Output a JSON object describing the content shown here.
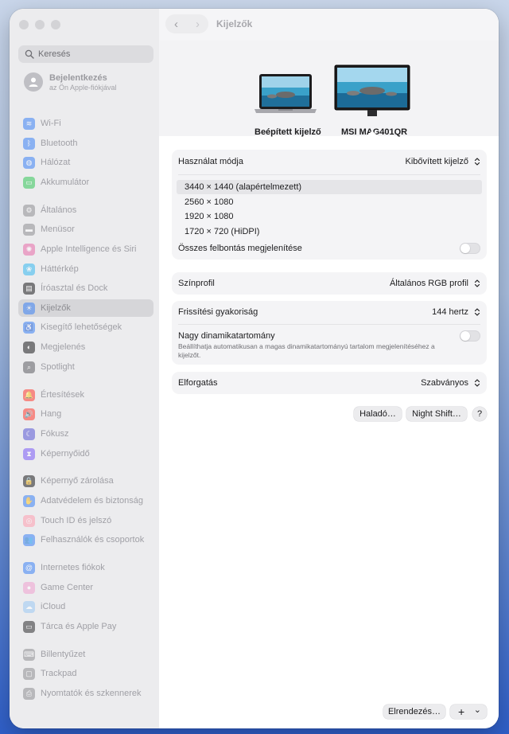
{
  "search": {
    "placeholder": "Keresés"
  },
  "account": {
    "title": "Bejelentkezés",
    "subtitle": "az Ön Apple-fiókjával"
  },
  "sidebar": {
    "items": [
      {
        "label": "Wi-Fi",
        "icon": "wifi-icon",
        "color": "#3b82f6",
        "glyph": "≋",
        "selected": false
      },
      {
        "label": "Bluetooth",
        "icon": "bluetooth-icon",
        "color": "#3b82f6",
        "glyph": "ᛒ",
        "selected": false
      },
      {
        "label": "Hálózat",
        "icon": "globe-icon",
        "color": "#3b82f6",
        "glyph": "◍",
        "selected": false
      },
      {
        "label": "Akkumulátor",
        "icon": "battery-icon",
        "color": "#34c759",
        "glyph": "▭",
        "selected": false
      },
      {
        "label": "Általános",
        "icon": "gear-icon",
        "color": "#8e8e93",
        "glyph": "⚙",
        "selected": false
      },
      {
        "label": "Menüsor",
        "icon": "menubar-icon",
        "color": "#8e8e93",
        "glyph": "▬",
        "selected": false
      },
      {
        "label": "Apple Intelligence és Siri",
        "icon": "siri-icon",
        "color": "#e86ba8",
        "glyph": "✺",
        "selected": false
      },
      {
        "label": "Háttérkép",
        "icon": "wallpaper-icon",
        "color": "#35b8f0",
        "glyph": "❀",
        "selected": false
      },
      {
        "label": "Íróasztal és Dock",
        "icon": "dock-icon",
        "color": "#1d1d1f",
        "glyph": "▤",
        "selected": false
      },
      {
        "label": "Kijelzők",
        "icon": "display-brightness-icon",
        "color": "#3b82f6",
        "glyph": "☀",
        "selected": true
      },
      {
        "label": "Kisegítő lehetőségek",
        "icon": "accessibility-icon",
        "color": "#3b82f6",
        "glyph": "♿",
        "selected": false
      },
      {
        "label": "Megjelenés",
        "icon": "appearance-icon",
        "color": "#1d1d1f",
        "glyph": "◐",
        "selected": false
      },
      {
        "label": "Spotlight",
        "icon": "spotlight-icon",
        "color": "#5e5e63",
        "glyph": "⌕",
        "selected": false
      },
      {
        "label": "Értesítések",
        "icon": "notifications-icon",
        "color": "#ff3b30",
        "glyph": "🔔",
        "selected": false
      },
      {
        "label": "Hang",
        "icon": "sound-icon",
        "color": "#ff3b30",
        "glyph": "🔊",
        "selected": false
      },
      {
        "label": "Fókusz",
        "icon": "focus-moon-icon",
        "color": "#5856d6",
        "glyph": "☾",
        "selected": false
      },
      {
        "label": "Képernyőidő",
        "icon": "hourglass-icon",
        "color": "#7a5af8",
        "glyph": "⧗",
        "selected": false
      },
      {
        "label": "Képernyő zárolása",
        "icon": "lock-icon",
        "color": "#1d1d1f",
        "glyph": "🔒",
        "selected": false
      },
      {
        "label": "Adatvédelem és biztonság",
        "icon": "privacy-hand-icon",
        "color": "#3b82f6",
        "glyph": "✋",
        "selected": false
      },
      {
        "label": "Touch ID és jelszó",
        "icon": "fingerprint-icon",
        "color": "#ff9db0",
        "glyph": "◎",
        "selected": false
      },
      {
        "label": "Felhasználók és csoportok",
        "icon": "users-icon",
        "color": "#3b82f6",
        "glyph": "👥",
        "selected": false
      },
      {
        "label": "Internetes fiókok",
        "icon": "at-sign-icon",
        "color": "#3b82f6",
        "glyph": "@",
        "selected": false
      },
      {
        "label": "Game Center",
        "icon": "game-center-icon",
        "color": "#f0a0d0",
        "glyph": "●",
        "selected": false
      },
      {
        "label": "iCloud",
        "icon": "icloud-icon",
        "color": "#9cc8f5",
        "glyph": "☁",
        "selected": false
      },
      {
        "label": "Tárca és Apple Pay",
        "icon": "wallet-icon",
        "color": "#2c2c2e",
        "glyph": "▭",
        "selected": false
      },
      {
        "label": "Billentyűzet",
        "icon": "keyboard-icon",
        "color": "#8e8e93",
        "glyph": "⌨",
        "selected": false
      },
      {
        "label": "Trackpad",
        "icon": "trackpad-icon",
        "color": "#8e8e93",
        "glyph": "▢",
        "selected": false
      },
      {
        "label": "Nyomtatók és szkennerek",
        "icon": "printer-icon",
        "color": "#8e8e93",
        "glyph": "⎙",
        "selected": false
      }
    ]
  },
  "header": {
    "title": "Kijelzők"
  },
  "displays": [
    {
      "label": "Beépített kijelző",
      "selected": false
    },
    {
      "label": "MSI MAG401QR",
      "selected": true
    }
  ],
  "settings": {
    "usage_mode": {
      "label": "Használat módja",
      "value": "Kibővített kijelző"
    },
    "resolutions": [
      {
        "label": "3440 × 1440 (alapértelmezett)",
        "selected": true
      },
      {
        "label": "2560 × 1080",
        "selected": false
      },
      {
        "label": "1920 × 1080",
        "selected": false
      },
      {
        "label": "1720 × 720 (HiDPI)",
        "selected": false
      }
    ],
    "show_all": {
      "label": "Összes felbontás megjelenítése",
      "on": false
    },
    "color_profile": {
      "label": "Színprofil",
      "value": "Általános RGB profil"
    },
    "refresh_rate": {
      "label": "Frissítési gyakoriság",
      "value": "144 hertz"
    },
    "hdr": {
      "label": "Nagy dinamikatartomány",
      "description": "Beállíthatja automatikusan a magas dinamikatartományú tartalom megjelenítéséhez a kijelzőt.",
      "on": false
    },
    "rotation": {
      "label": "Elforgatás",
      "value": "Szabványos"
    }
  },
  "buttons": {
    "advanced": "Haladó…",
    "night_shift": "Night Shift…",
    "help": "?",
    "arrange": "Elrendezés…",
    "add": "+",
    "dropdown": "⌄"
  }
}
